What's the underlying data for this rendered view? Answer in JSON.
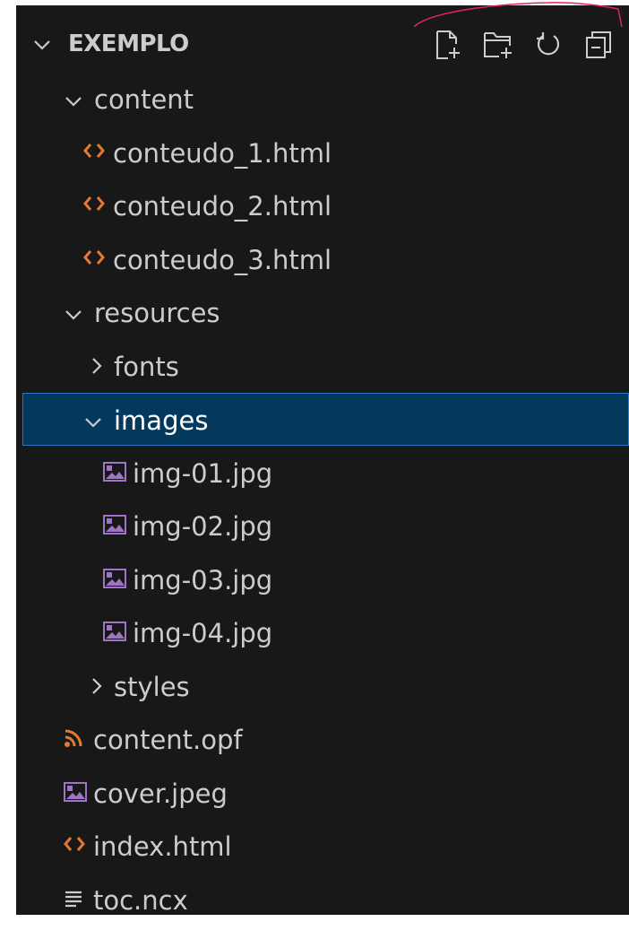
{
  "explorer": {
    "title": "EXEMPLO",
    "actions": [
      {
        "name": "new-file-icon"
      },
      {
        "name": "new-folder-icon"
      },
      {
        "name": "refresh-icon"
      },
      {
        "name": "collapse-all-icon"
      }
    ]
  },
  "tree": [
    {
      "label": "content",
      "kind": "folder",
      "expanded": true
    },
    {
      "label": "conteudo_1.html",
      "kind": "html"
    },
    {
      "label": "conteudo_2.html",
      "kind": "html"
    },
    {
      "label": "conteudo_3.html",
      "kind": "html"
    },
    {
      "label": "resources",
      "kind": "folder",
      "expanded": true
    },
    {
      "label": "fonts",
      "kind": "folder",
      "expanded": false
    },
    {
      "label": "images",
      "kind": "folder",
      "expanded": true,
      "selected": true
    },
    {
      "label": "img-01.jpg",
      "kind": "image"
    },
    {
      "label": "img-02.jpg",
      "kind": "image"
    },
    {
      "label": "img-03.jpg",
      "kind": "image"
    },
    {
      "label": "img-04.jpg",
      "kind": "image"
    },
    {
      "label": "styles",
      "kind": "folder",
      "expanded": false
    },
    {
      "label": "content.opf",
      "kind": "rss"
    },
    {
      "label": "cover.jpeg",
      "kind": "image"
    },
    {
      "label": "index.html",
      "kind": "html"
    },
    {
      "label": "toc.ncx",
      "kind": "text"
    }
  ],
  "colors": {
    "background": "#181818",
    "text": "#cccccc",
    "selection": "#04395e",
    "selection_border": "#2b79c4",
    "html_icon": "#e37933",
    "image_icon": "#a074c4",
    "rss_icon": "#e37933",
    "annotation": "#e0245e"
  }
}
